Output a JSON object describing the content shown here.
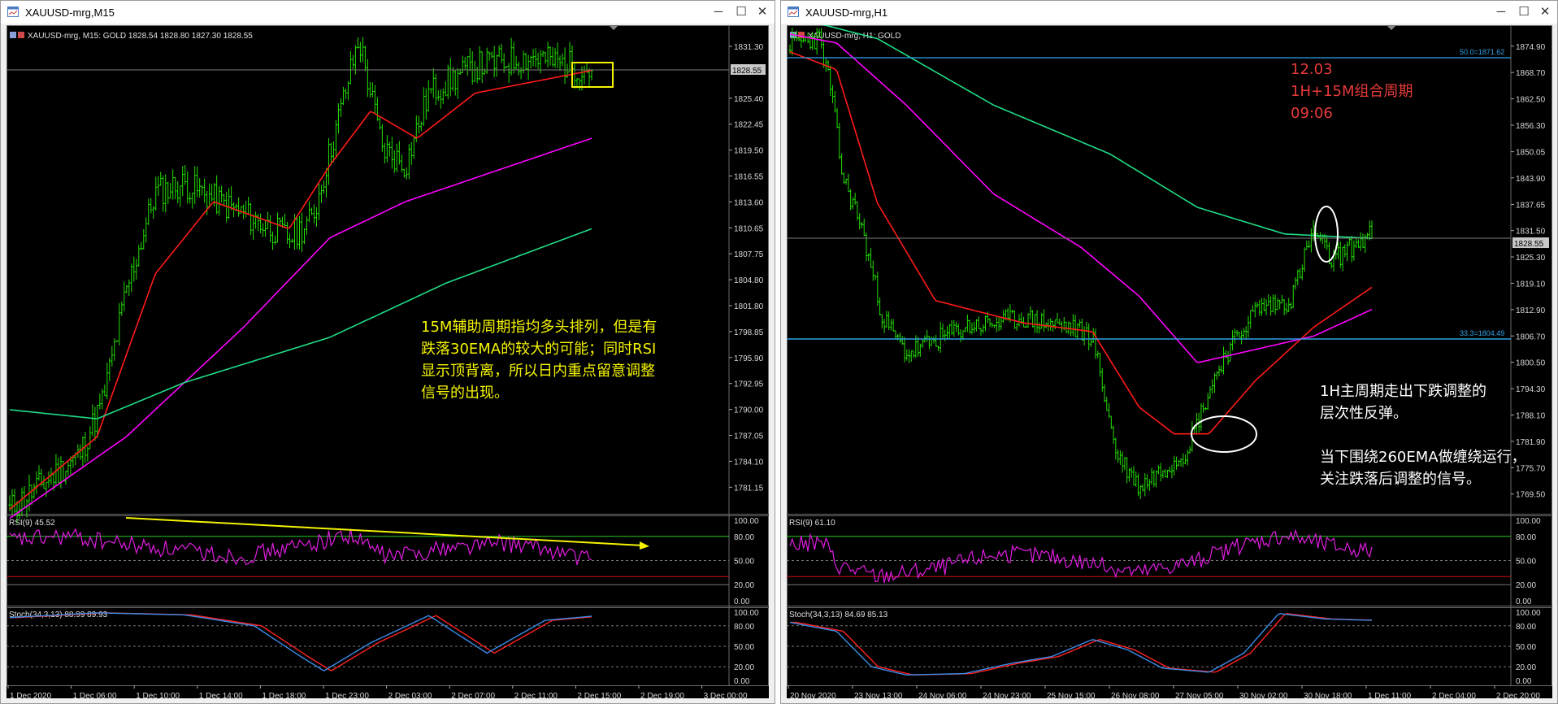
{
  "windows": [
    {
      "title": "XAUUSD-mrg,M15",
      "info": "XAUUSD-mrg, M15:  GOLD  1828.54 1828.80 1827.30 1828.55",
      "price_labels": [
        "1831.30",
        "1828.55",
        "1825.40",
        "1822.45",
        "1819.50",
        "1816.55",
        "1813.60",
        "1810.65",
        "1807.75",
        "1804.80",
        "1801.80",
        "1798.85",
        "1795.90",
        "1792.95",
        "1790.00",
        "1787.05",
        "1784.10",
        "1781.15"
      ],
      "current_price": "1828.55",
      "rsi_label": "RSI(9) 45.52",
      "rsi_levels": [
        "100.00",
        "80.00",
        "50.00",
        "20.00",
        "0.00"
      ],
      "stoch_label": "Stoch(34,3,13) 88.99 89.93",
      "stoch_levels": [
        "100.00",
        "80.00",
        "50.00",
        "20.00",
        "0.00"
      ],
      "time_labels": [
        "1 Dec 2020",
        "1 Dec 06:00",
        "1 Dec 10:00",
        "1 Dec 14:00",
        "1 Dec 18:00",
        "1 Dec 23:00",
        "2 Dec 03:00",
        "2 Dec 07:00",
        "2 Dec 11:00",
        "2 Dec 15:00",
        "2 Dec 19:00",
        "3 Dec 00:00"
      ],
      "annotation": [
        "15M辅助周期指均多头排列，但是有",
        "跌落30EMA的较大的可能；同时RSI",
        "显示顶背离，所以日内重点留意调整",
        "信号的出现。"
      ],
      "annotation_color": "#f4f400"
    },
    {
      "title": "XAUUSD-mrg,H1",
      "info": "XAUUSD-mrg, H1:  GOLD",
      "price_labels": [
        "1874.90",
        "1868.70",
        "1862.50",
        "1856.30",
        "1850.05",
        "1843.90",
        "1837.65",
        "1831.50",
        "1828.55",
        "1825.30",
        "1819.10",
        "1812.90",
        "1806.70",
        "1800.50",
        "1794.30",
        "1788.10",
        "1781.90",
        "1775.70",
        "1769.50"
      ],
      "current_price": "1828.55",
      "fib_top": "50.0=1871.62",
      "fib_bottom": "33.3=1804.49",
      "rsi_label": "RSI(9) 61.10",
      "rsi_levels": [
        "100.00",
        "80.00",
        "50.00",
        "20.00",
        "0.00"
      ],
      "stoch_label": "Stoch(34,3,13) 84.69 85.13",
      "stoch_levels": [
        "100.00",
        "80.00",
        "50.00",
        "20.00",
        "0.00"
      ],
      "time_labels": [
        "20 Nov 2020",
        "23 Nov 13:00",
        "24 Nov 06:00",
        "24 Nov 23:00",
        "25 Nov 15:00",
        "26 Nov 08:00",
        "27 Nov 05:00",
        "30 Nov 02:00",
        "30 Nov 18:00",
        "1 Dec 11:00",
        "2 Dec 04:00",
        "2 Dec 20:00"
      ],
      "header_note": [
        "12.03",
        "1H+15M组合周期",
        "09:06"
      ],
      "header_note_color": "#e83a3a",
      "annotation": [
        "1H主周期走出下跌调整的",
        "层次性反弹。",
        "",
        "当下围绕260EMA做缠绕运行，",
        "关注跌落后调整的信号。"
      ],
      "annotation_color": "#ffffff"
    }
  ],
  "colors": {
    "bull": "#22e000",
    "ema_fast": "#ff1a1a",
    "ema_mid": "#ff00ff",
    "ema_slow": "#1fdc85",
    "fib_line": "#2fa0e6",
    "rsi": "#e21de2",
    "stoch_main": "#3c8ce8",
    "stoch_signal": "#ff2222",
    "level_line": "#22cc22",
    "oversold_line": "#d01010"
  }
}
